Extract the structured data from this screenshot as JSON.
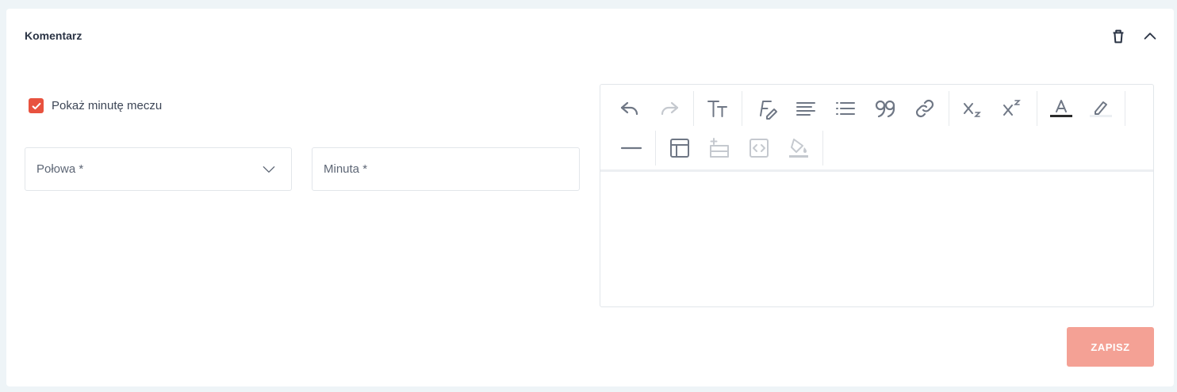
{
  "card": {
    "title": "Komentarz"
  },
  "header": {
    "delete_icon": "trash-icon",
    "collapse_icon": "chevron-up-icon"
  },
  "form": {
    "show_minute": {
      "label": "Pokaż minutę meczu",
      "checked": true
    },
    "half_select": {
      "placeholder": "Połowa *",
      "icon": "chevron-down-icon"
    },
    "minute_input": {
      "placeholder": "Minuta *"
    }
  },
  "editor": {
    "toolbar": [
      "undo-icon",
      "redo-icon",
      "font-size-icon",
      "font-style-icon",
      "align-icon",
      "list-icon",
      "blockquote-icon",
      "link-icon",
      "subscript-icon",
      "superscript-icon",
      "font-color-icon",
      "highlight-icon",
      "horizontal-rule-icon",
      "table-icon",
      "insert-row-icon",
      "code-block-icon",
      "format-painter-icon"
    ],
    "content": ""
  },
  "actions": {
    "save_label": "ZAPISZ"
  },
  "colors": {
    "accent": "#e8523f",
    "save_disabled": "#f4a195",
    "background": "#eef4f7"
  }
}
